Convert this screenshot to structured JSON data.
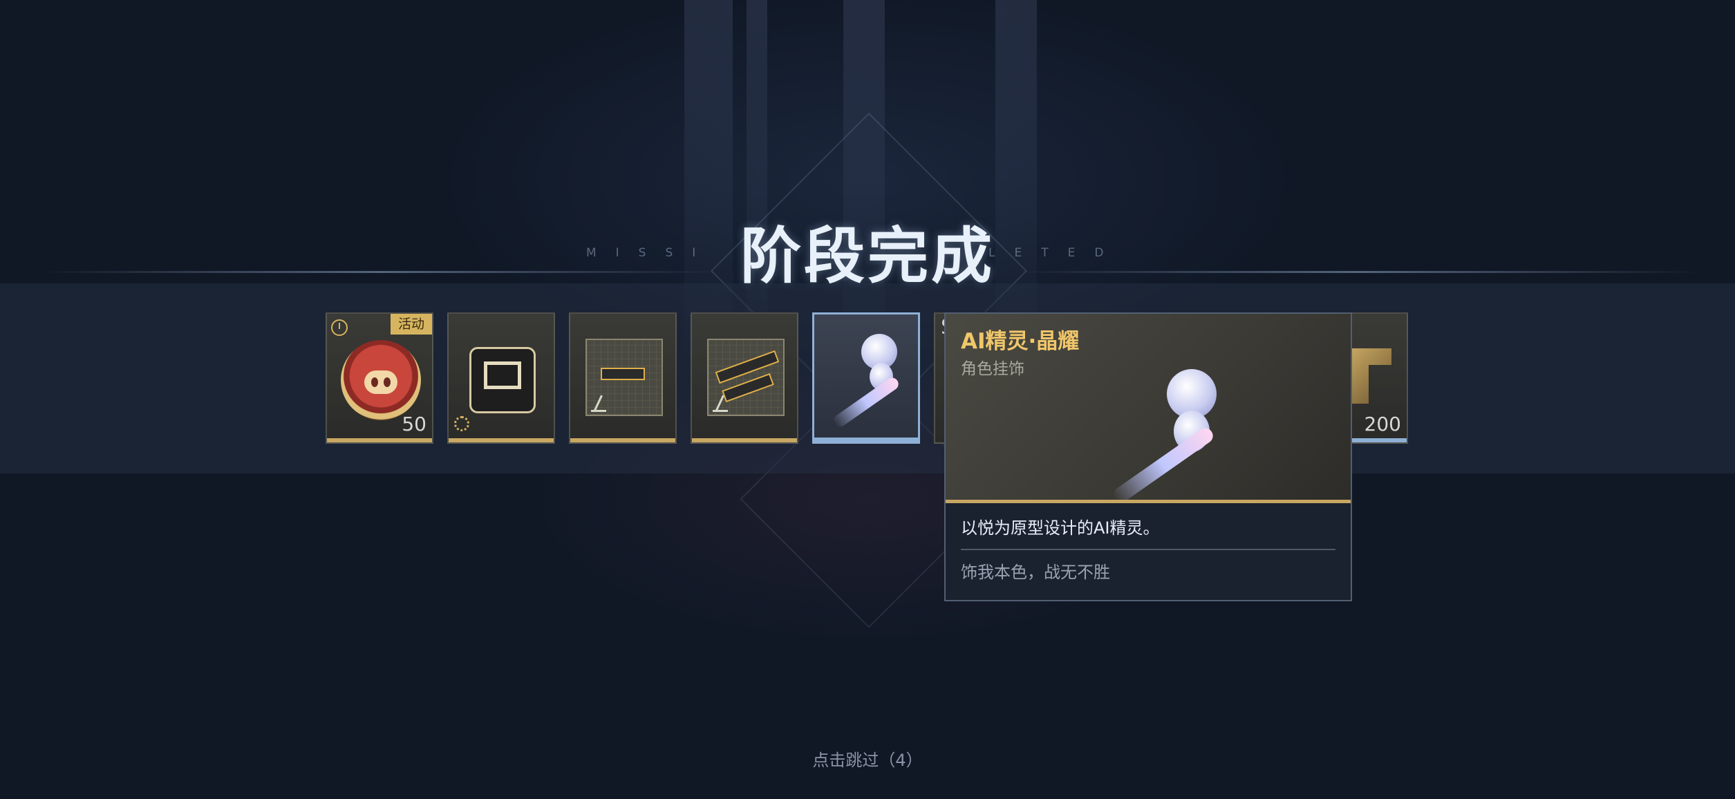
{
  "title": "阶段完成",
  "subtitle_left": "MISSI",
  "subtitle_right": "LETED",
  "rewards": [
    {
      "tag": "活动",
      "count": "50",
      "icon": "pig-coin-icon"
    },
    {
      "count": "",
      "icon": "chest-icon"
    },
    {
      "count": "",
      "icon": "pistol-blueprint-icon"
    },
    {
      "count": "",
      "icon": "rifle-blueprint-icon"
    },
    {
      "count": "",
      "icon": "ai-sprite-icon",
      "selected": true
    },
    {
      "partial_label": "S",
      "icon": "partial-item-icon"
    },
    {
      "count": "200",
      "icon": "emblem-icon"
    }
  ],
  "tooltip": {
    "name": "AI精灵·晶耀",
    "type": "角色挂饰",
    "description": "以悦为原型设计的AI精灵。",
    "flavor": "饰我本色，战无不胜"
  },
  "skip_label": "点击跳过（4）",
  "colors": {
    "gold": "#c8a762",
    "selected": "#8fb0d6",
    "title": "#e8f0fa"
  }
}
